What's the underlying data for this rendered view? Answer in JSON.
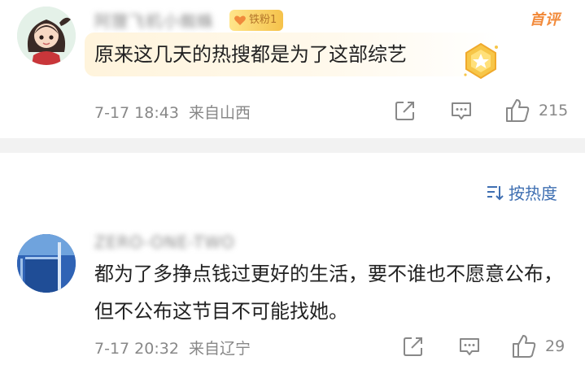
{
  "comments": [
    {
      "username": "阿狸飞机小蜘蛛",
      "fan_badge": "铁粉1",
      "tag": "首评",
      "text": "原来这几天的热搜都是为了这部综艺",
      "time": "7-17 18:43",
      "location": "来自山西",
      "likes": "215",
      "avatar_icon": "cartoon-girl-avatar",
      "medal_icon": "gold-medal-icon"
    },
    {
      "username": "ZERO-ONE-TWO",
      "text": "都为了多挣点钱过更好的生活，要不谁也不愿意公布，但不公布这节目不可能找她。",
      "time": "7-17 20:32",
      "location": "来自辽宁",
      "likes": "29",
      "avatar_icon": "blue-building-avatar"
    }
  ],
  "sort": {
    "label": "按热度",
    "icon": "sort-icon"
  },
  "colors": {
    "link_blue": "#3f6fb2",
    "tag_orange": "#f28a3a",
    "meta_gray": "#888888"
  }
}
